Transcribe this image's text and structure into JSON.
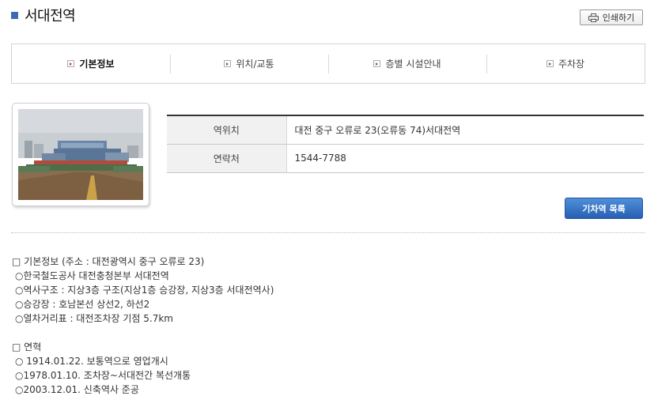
{
  "page": {
    "title": "서대전역",
    "print_label": "인쇄하기"
  },
  "tabs": [
    {
      "label": "기본정보",
      "active": true
    },
    {
      "label": "위치/교통",
      "active": false
    },
    {
      "label": "층별 시설안내",
      "active": false
    },
    {
      "label": "주차장",
      "active": false
    }
  ],
  "info": {
    "rows": [
      {
        "label": "역위치",
        "value": "대전 중구 오류로 23(오류동 74)서대전역"
      },
      {
        "label": "연락처",
        "value": "1544-7788"
      }
    ]
  },
  "list_button": "기차역 목록",
  "description": {
    "sections": [
      {
        "heading": "□ 기본정보 (주소 : 대전광역시 중구 오류로 23)",
        "lines": [
          "○한국철도공사 대전충청본부 서대전역",
          "○역사구조 : 지상3층 구조(지상1층 승강장, 지상3층 서대전역사)",
          "○승강장 : 호남본선 상선2, 하선2",
          "○열차거리표 : 대전조차장 기점 5.7km"
        ]
      },
      {
        "heading": "□ 연혁",
        "lines": [
          "○ 1914.01.22. 보통역으로 영업개시",
          "○1978.01.10. 조차장~서대전간 복선개통",
          "○2003.12.01. 신축역사 준공"
        ]
      }
    ]
  },
  "colors": {
    "accent": "#3d6bb3",
    "button_blue": "#2f6cc0",
    "active_bullet": "#c0392b"
  }
}
